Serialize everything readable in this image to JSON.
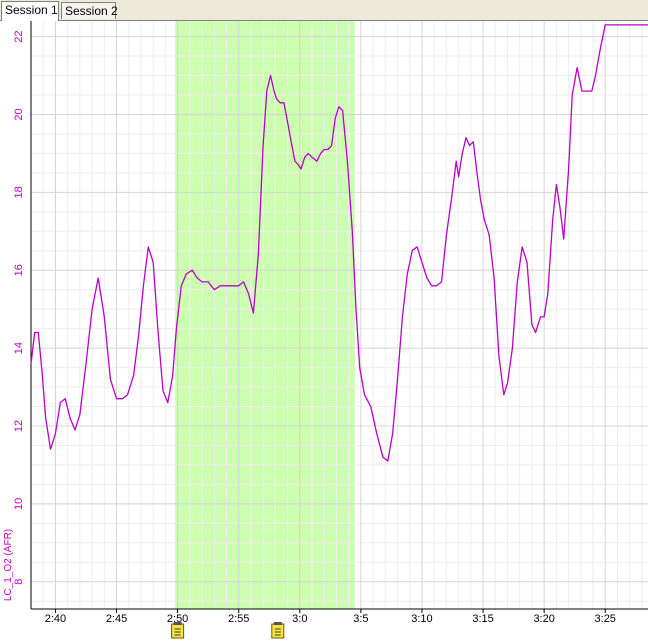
{
  "tabs": [
    {
      "label": "Session 1",
      "active": true
    },
    {
      "label": "Session 2",
      "active": false
    }
  ],
  "chart_data": {
    "type": "line",
    "title": "",
    "ylabel": "LC_1_O2 (AFR)",
    "xlabel": "",
    "ylim": [
      7.3,
      22.4
    ],
    "xlim": [
      158.0,
      208.5
    ],
    "grid": true,
    "y_ticks": [
      8,
      10,
      12,
      14,
      16,
      18,
      20,
      22
    ],
    "x_tick_labels": [
      "2:40",
      "2:45",
      "2:50",
      "2:55",
      "3:0",
      "3:5",
      "3:10",
      "3:15",
      "3:20",
      "3:25"
    ],
    "x_tick_values": [
      160,
      165,
      170,
      175,
      180,
      185,
      190,
      195,
      200,
      205
    ],
    "highlight_range": [
      169.8,
      184.5
    ],
    "highlight_color": "#ccffb0",
    "line_color": "#bb00cc",
    "note_markers_x": [
      170,
      178.2
    ],
    "series": [
      {
        "x": [
          158.0,
          158.3,
          158.6,
          158.9,
          159.2,
          159.6,
          160.0,
          160.4,
          160.8,
          161.2,
          161.6,
          162.0,
          162.5,
          163.0,
          163.5,
          164.0,
          164.5,
          165.0,
          165.5,
          165.9,
          166.4,
          166.8,
          167.2,
          167.6,
          168.0,
          168.4,
          168.8,
          169.2,
          169.6,
          169.9,
          170.3,
          170.7,
          171.2,
          171.6,
          172.0,
          172.5,
          173.0,
          173.5,
          174.0,
          174.5,
          175.0,
          175.4,
          175.8,
          176.2,
          176.6,
          177.0,
          177.3,
          177.6,
          177.9,
          178.1,
          178.4,
          178.7,
          179.0,
          179.3,
          179.6,
          179.9,
          180.1,
          180.4,
          180.7,
          181.0,
          181.4,
          181.7,
          182.0,
          182.3,
          182.6,
          182.9,
          183.2,
          183.5,
          183.9,
          184.3,
          184.6,
          184.9,
          185.3,
          185.8,
          186.3,
          186.8,
          187.2,
          187.6,
          188.0,
          188.4,
          188.8,
          189.2,
          189.6,
          190.0,
          190.4,
          190.8,
          191.2,
          191.6,
          192.0,
          192.4,
          192.8,
          193.0,
          193.3,
          193.6,
          193.9,
          194.2,
          194.5,
          194.8,
          195.1,
          195.5,
          195.9,
          196.3,
          196.7,
          197.0,
          197.4,
          197.8,
          198.2,
          198.6,
          199.0,
          199.3,
          199.7,
          200.0,
          200.3,
          200.7,
          201.0,
          201.3,
          201.6,
          202.0,
          202.3,
          202.7,
          203.1,
          203.5,
          203.9,
          204.2,
          204.6,
          205.0,
          205.3,
          205.7,
          206.1,
          206.5,
          207.0,
          207.5,
          208.0,
          208.5
        ],
        "values": [
          13.6,
          14.4,
          14.4,
          13.4,
          12.2,
          11.4,
          11.8,
          12.6,
          12.7,
          12.2,
          11.9,
          12.3,
          13.6,
          15.0,
          15.8,
          14.8,
          13.2,
          12.7,
          12.7,
          12.8,
          13.3,
          14.3,
          15.6,
          16.6,
          16.2,
          14.4,
          12.9,
          12.6,
          13.3,
          14.5,
          15.6,
          15.9,
          16.0,
          15.8,
          15.7,
          15.7,
          15.5,
          15.6,
          15.6,
          15.6,
          15.6,
          15.7,
          15.4,
          14.9,
          16.4,
          19.2,
          20.6,
          21.0,
          20.6,
          20.4,
          20.3,
          20.3,
          19.8,
          19.3,
          18.8,
          18.7,
          18.6,
          18.9,
          19.0,
          18.9,
          18.8,
          19.0,
          19.1,
          19.1,
          19.2,
          19.9,
          20.2,
          20.1,
          18.8,
          17.0,
          15.0,
          13.5,
          12.8,
          12.5,
          11.8,
          11.2,
          11.1,
          11.8,
          13.2,
          14.8,
          15.9,
          16.5,
          16.6,
          16.2,
          15.8,
          15.6,
          15.6,
          15.7,
          16.9,
          17.8,
          18.8,
          18.4,
          19.0,
          19.4,
          19.2,
          19.3,
          18.5,
          17.8,
          17.3,
          16.9,
          15.8,
          13.8,
          12.8,
          13.1,
          14.0,
          15.7,
          16.6,
          16.2,
          14.6,
          14.4,
          14.8,
          14.8,
          15.4,
          17.3,
          18.2,
          17.6,
          16.8,
          18.6,
          20.5,
          21.2,
          20.6,
          20.6,
          20.6,
          21.0,
          21.7,
          22.3,
          22.3,
          22.3,
          22.3,
          22.3,
          22.3,
          22.3,
          22.3,
          22.3
        ]
      }
    ]
  }
}
